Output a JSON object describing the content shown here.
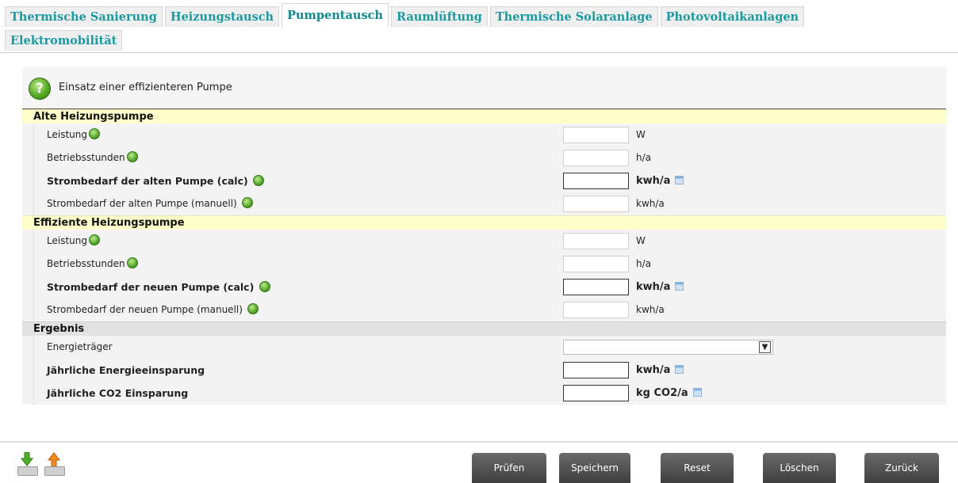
{
  "tabs": {
    "row1": [
      "Thermische Sanierung",
      "Heizungstausch",
      "Pumpentausch",
      "Raumlüftung",
      "Thermische Solaranlage",
      "Photovoltaikanlagen"
    ],
    "row2": [
      "Elektromobilität"
    ],
    "active": "Pumpentausch"
  },
  "panel": {
    "title": "Einsatz einer effizienteren Pumpe"
  },
  "sections": {
    "alt": {
      "title": "Alte Heizungspumpe",
      "leistung": "Leistung",
      "leistung_unit": "W",
      "betrieb": "Betriebsstunden",
      "betrieb_unit": "h/a",
      "calc": "Strombedarf der alten Pumpe (calc)",
      "calc_unit": "kwh/a",
      "manuell": "Strombedarf der alten Pumpe (manuell)",
      "manuell_unit": "kwh/a"
    },
    "neu": {
      "title": "Effiziente Heizungspumpe",
      "leistung": "Leistung",
      "leistung_unit": "W",
      "betrieb": "Betriebsstunden",
      "betrieb_unit": "h/a",
      "calc": "Strombedarf der neuen Pumpe (calc)",
      "calc_unit": "kwh/a",
      "manuell": "Strombedarf der neuen Pumpe (manuell)",
      "manuell_unit": "kwh/a"
    },
    "ergebnis": {
      "title": "Ergebnis",
      "energietraeger": "Energieträger",
      "energietraeger_value": "",
      "einsparung": "Jährliche Energieeinsparung",
      "einsparung_unit": "kwh/a",
      "co2": "Jährliche CO2 Einsparung",
      "co2_unit": "kg CO2/a"
    }
  },
  "footer": {
    "buttons": [
      "Prüfen",
      "Speichern",
      "Reset",
      "Löschen",
      "Zurück"
    ],
    "icons": [
      "download-icon",
      "upload-icon"
    ]
  }
}
